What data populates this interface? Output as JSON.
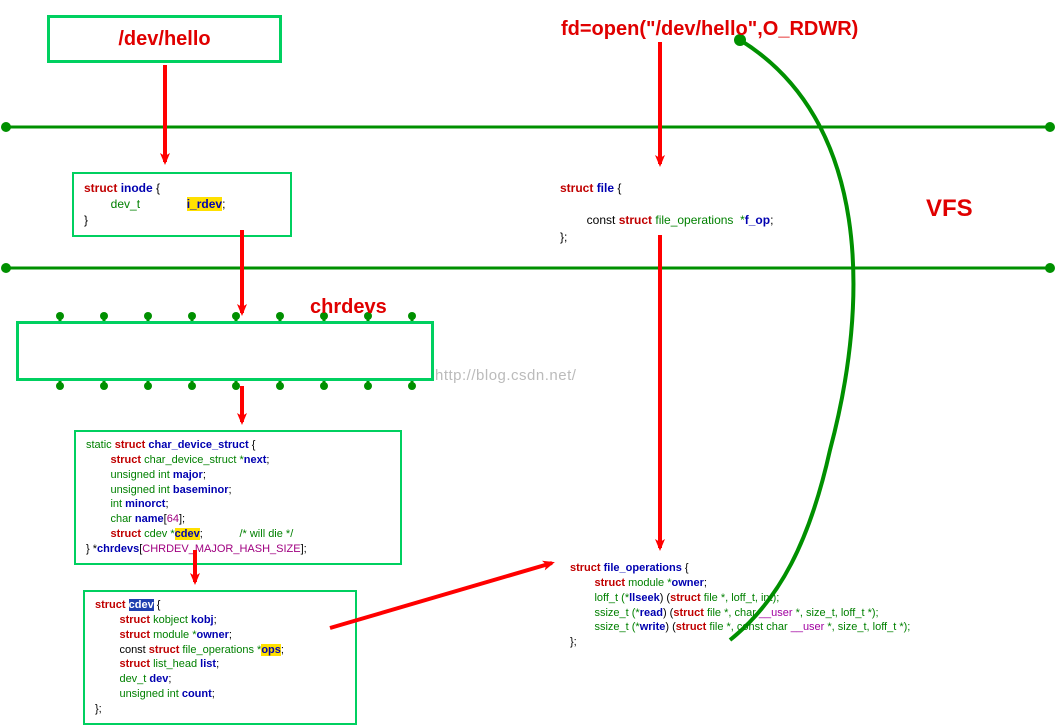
{
  "top_box": "/dev/hello",
  "fd_call": "fd=open(\"/dev/hello\",O_RDWR)",
  "vfs_label": "VFS",
  "chrdevs_label": "chrdevs",
  "watermark": "http://blog.csdn.net/",
  "inode": {
    "line1_kw": "struct ",
    "line1_name": "inode",
    "line1_tail": " {",
    "line2_type": "        dev_t              ",
    "line2_field": "i_rdev",
    "line2_sc": ";",
    "line3": "}"
  },
  "file": {
    "line1_kw": "struct ",
    "line1_name": "file",
    "line1_tail": " {",
    "line2a": "        const ",
    "line2b": "struct",
    "line2c": " file_operations  *",
    "line2d": "f_op",
    "line2e": ";",
    "line3": "};"
  },
  "cds": {
    "l1a": "static ",
    "l1b": "struct ",
    "l1c": "char_device_struct",
    "l1d": " {",
    "l2a": "        struct",
    "l2b": " char_device_struct *",
    "l2c": "next",
    "l2d": ";",
    "l3a": "        unsigned int ",
    "l3b": "major",
    "l3c": ";",
    "l4a": "        unsigned int ",
    "l4b": "baseminor",
    "l4c": ";",
    "l5a": "        int ",
    "l5b": "minorct",
    "l5c": ";",
    "l6a": "        char ",
    "l6b": "name",
    "l6c": "[",
    "l6d": "64",
    "l6e": "];",
    "l7a": "        struct",
    "l7b": " cdev *",
    "l7c": "cdev",
    "l7d": ";            ",
    "l7e": "/* will die */",
    "l8a": "} *",
    "l8b": "chrdevs",
    "l8c": "[",
    "l8d": "CHRDEV_MAJOR_HASH_SIZE",
    "l8e": "];"
  },
  "cdev": {
    "l1a": "struct ",
    "l1b": "cdev",
    "l1c": " {",
    "l2a": "        struct",
    "l2b": " kobject ",
    "l2c": "kobj",
    "l2d": ";",
    "l3a": "        struct",
    "l3b": " module *",
    "l3c": "owner",
    "l3d": ";",
    "l4a": "        const ",
    "l4b": "struct",
    "l4c": " file_operations *",
    "l4d": "ops",
    "l4e": ";",
    "l5a": "        struct",
    "l5b": " list_head ",
    "l5c": "list",
    "l5d": ";",
    "l6a": "        dev_t ",
    "l6b": "dev",
    "l6c": ";",
    "l7a": "        unsigned int ",
    "l7b": "count",
    "l7c": ";",
    "l8": "};"
  },
  "fops": {
    "l1a": "struct ",
    "l1b": "file_operations",
    "l1c": " {",
    "l2a": "        struct",
    "l2b": " module *",
    "l2c": "owner",
    "l2d": ";",
    "l3a": "        loff_t (*",
    "l3b": "llseek",
    "l3c": ") (",
    "l3d": "struct",
    "l3e": " file *, loff_t, int);",
    "l4a": "        ssize_t (*",
    "l4b": "read",
    "l4c": ") (",
    "l4d": "struct",
    "l4e": " file *, char ",
    "l4f": "__user",
    "l4g": " *, size_t, loff_t *);",
    "l5a": "        ssize_t (*",
    "l5b": "write",
    "l5c": ") (",
    "l5d": "struct",
    "l5e": " file *, const char ",
    "l5f": "__user",
    "l5g": " *, size_t, loff_t *);",
    "l6": "};"
  }
}
